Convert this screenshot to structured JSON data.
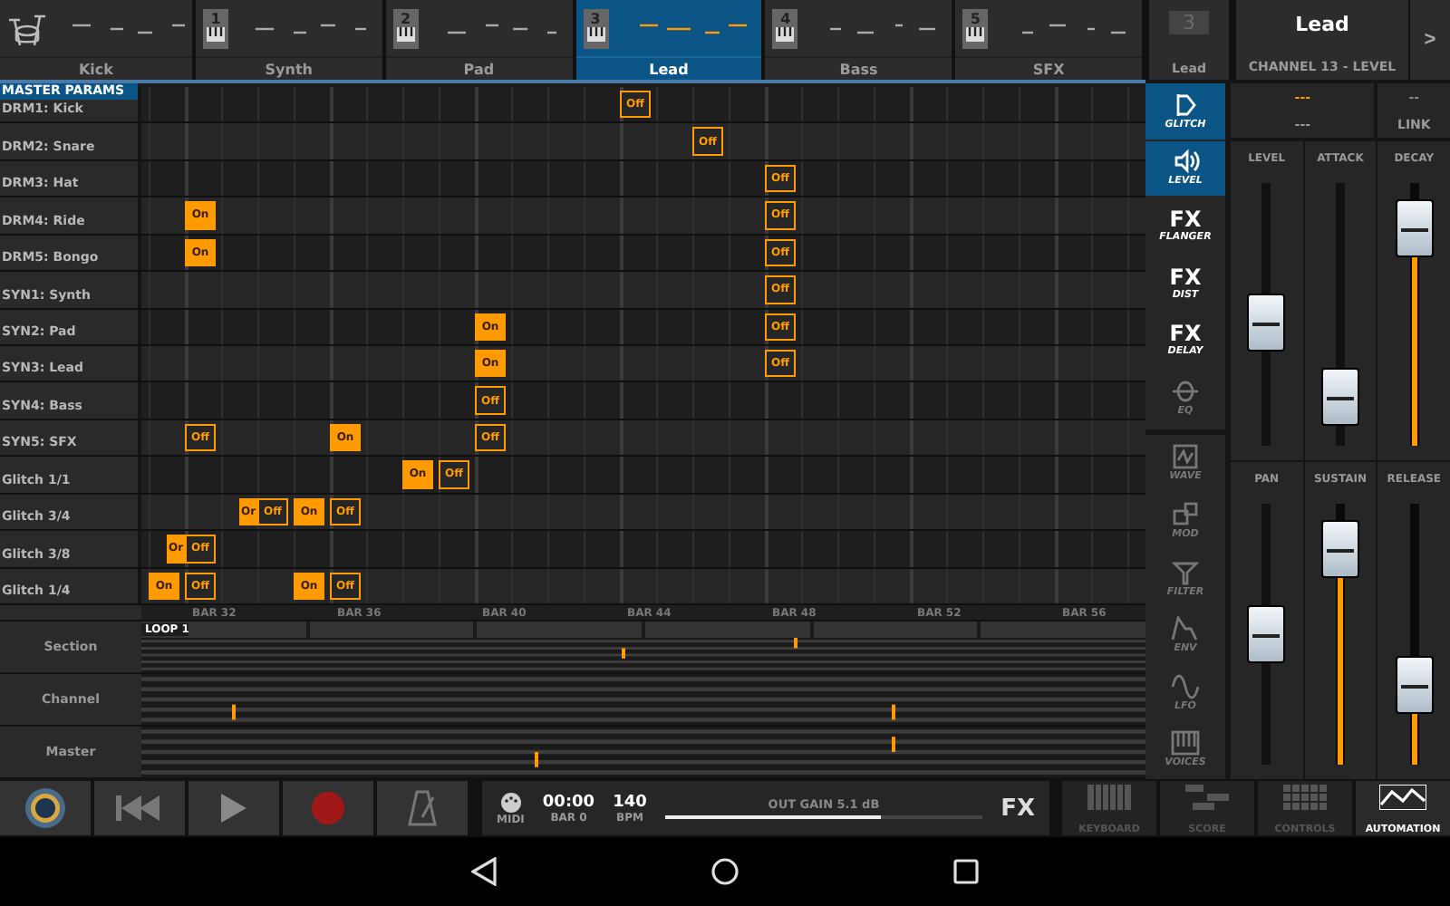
{
  "tabs": [
    {
      "label": "Kick",
      "kind": "drum",
      "selected": false
    },
    {
      "label": "Synth",
      "kind": "synth",
      "number": "1",
      "selected": false
    },
    {
      "label": "Pad",
      "kind": "synth",
      "number": "2",
      "selected": false
    },
    {
      "label": "Lead",
      "kind": "synth",
      "number": "3",
      "selected": true
    },
    {
      "label": "Bass",
      "kind": "synth",
      "number": "4",
      "selected": false
    },
    {
      "label": "SFX",
      "kind": "synth",
      "number": "5",
      "selected": false
    }
  ],
  "channel_box": {
    "number": "3",
    "label": "Lead"
  },
  "channel_title": {
    "name": "Lead",
    "subtitle": "CHANNEL 13 - LEVEL",
    "next": ">"
  },
  "grid": {
    "header": "MASTER PARAMS",
    "rows": [
      {
        "label": "DRM1: Kick",
        "cells": [
          null,
          null,
          null,
          null,
          null,
          null,
          null,
          null,
          null,
          null,
          null,
          null,
          null,
          null,
          null,
          null,
          null,
          null,
          null,
          null,
          null,
          null,
          null,
          null,
          null,
          null,
          {
            "label": "Off",
            "kind": "off"
          }
        ]
      },
      {
        "label": "DRM2: Snare",
        "cells": [
          null,
          null,
          null,
          null,
          null,
          null,
          null,
          null,
          null,
          null,
          null,
          null,
          null,
          null,
          null,
          null,
          null,
          null,
          null,
          null,
          null,
          null,
          null,
          null,
          null,
          null,
          null,
          null,
          null,
          null,
          {
            "label": "Off",
            "kind": "off"
          }
        ]
      },
      {
        "label": "DRM3: Hat",
        "cells": [
          null,
          null,
          null,
          null,
          null,
          null,
          null,
          null,
          null,
          null,
          null,
          null,
          null,
          null,
          null,
          null,
          null,
          null,
          null,
          null,
          null,
          null,
          null,
          null,
          null,
          null,
          null,
          null,
          null,
          null,
          null,
          null,
          null,
          null,
          {
            "label": "Off",
            "kind": "off"
          }
        ]
      },
      {
        "label": "DRM4: Ride",
        "cells": [
          null,
          null,
          {
            "label": "On",
            "kind": "on"
          },
          null,
          null,
          null,
          null,
          null,
          null,
          null,
          null,
          null,
          null,
          null,
          null,
          null,
          null,
          null,
          null,
          null,
          null,
          null,
          null,
          null,
          null,
          null,
          null,
          null,
          null,
          null,
          null,
          null,
          null,
          null,
          {
            "label": "Off",
            "kind": "off"
          }
        ]
      },
      {
        "label": "DRM5: Bongo",
        "cells": [
          null,
          null,
          {
            "label": "On",
            "kind": "on"
          },
          null,
          null,
          null,
          null,
          null,
          null,
          null,
          null,
          null,
          null,
          null,
          null,
          null,
          null,
          null,
          null,
          null,
          null,
          null,
          null,
          null,
          null,
          null,
          null,
          null,
          null,
          null,
          null,
          null,
          null,
          null,
          {
            "label": "Off",
            "kind": "off"
          }
        ]
      },
      {
        "label": "SYN1: Synth",
        "cells": [
          null,
          null,
          null,
          null,
          null,
          null,
          null,
          null,
          null,
          null,
          null,
          null,
          null,
          null,
          null,
          null,
          null,
          null,
          null,
          null,
          null,
          null,
          null,
          null,
          null,
          null,
          null,
          null,
          null,
          null,
          null,
          null,
          null,
          null,
          {
            "label": "Off",
            "kind": "off"
          }
        ]
      },
      {
        "label": "SYN2: Pad",
        "cells": [
          null,
          null,
          null,
          null,
          null,
          null,
          null,
          null,
          null,
          null,
          null,
          null,
          null,
          null,
          null,
          null,
          null,
          null,
          {
            "label": "On",
            "kind": "on"
          },
          null,
          null,
          null,
          null,
          null,
          null,
          null,
          null,
          null,
          null,
          null,
          null,
          null,
          null,
          null,
          {
            "label": "Off",
            "kind": "off"
          }
        ]
      },
      {
        "label": "SYN3: Lead",
        "cells": [
          null,
          null,
          null,
          null,
          null,
          null,
          null,
          null,
          null,
          null,
          null,
          null,
          null,
          null,
          null,
          null,
          null,
          null,
          {
            "label": "On",
            "kind": "on"
          },
          null,
          null,
          null,
          null,
          null,
          null,
          null,
          null,
          null,
          null,
          null,
          null,
          null,
          null,
          null,
          {
            "label": "Off",
            "kind": "off"
          }
        ]
      },
      {
        "label": "SYN4: Bass",
        "cells": [
          null,
          null,
          null,
          null,
          null,
          null,
          null,
          null,
          null,
          null,
          null,
          null,
          null,
          null,
          null,
          null,
          null,
          null,
          {
            "label": "Off",
            "kind": "off"
          }
        ]
      },
      {
        "label": "SYN5: SFX",
        "cells": [
          null,
          null,
          {
            "label": "Off",
            "kind": "off"
          },
          null,
          null,
          null,
          null,
          null,
          null,
          null,
          {
            "label": "On",
            "kind": "on"
          },
          null,
          null,
          null,
          null,
          null,
          null,
          null,
          {
            "label": "Off",
            "kind": "off"
          }
        ]
      },
      {
        "label": "Glitch 1/1",
        "cells": [
          null,
          null,
          null,
          null,
          null,
          null,
          null,
          null,
          null,
          null,
          null,
          null,
          null,
          null,
          {
            "label": "On",
            "kind": "on"
          },
          null,
          {
            "label": "Off",
            "kind": "off"
          }
        ]
      },
      {
        "label": "Glitch 3/4",
        "cells": [
          null,
          null,
          null,
          null,
          null,
          {
            "label": "Or",
            "kind": "on"
          },
          {
            "label": "Off",
            "kind": "off"
          },
          null,
          {
            "label": "On",
            "kind": "on"
          },
          null,
          {
            "label": "Off",
            "kind": "off"
          }
        ]
      },
      {
        "label": "Glitch 3/8",
        "cells": [
          null,
          {
            "label": "Or",
            "kind": "on"
          },
          {
            "label": "Off",
            "kind": "off"
          }
        ]
      },
      {
        "label": "Glitch 1/4",
        "cells": [
          {
            "label": "On",
            "kind": "on"
          },
          null,
          {
            "label": "Off",
            "kind": "off"
          },
          null,
          null,
          null,
          null,
          null,
          {
            "label": "On",
            "kind": "on"
          },
          null,
          {
            "label": "Off",
            "kind": "off"
          }
        ]
      }
    ],
    "bars": [
      "BAR 32",
      "BAR 36",
      "BAR 40",
      "BAR 44",
      "BAR 48",
      "BAR 52",
      "BAR 56"
    ]
  },
  "automation": {
    "lanes": [
      "Section",
      "Channel",
      "Master"
    ],
    "loop": "LOOP 1"
  },
  "modules": [
    {
      "label": "GLITCH",
      "kind": "glitch",
      "selected": true,
      "disabled": false
    },
    {
      "label": "LEVEL",
      "kind": "level",
      "selected": true,
      "disabled": false
    },
    {
      "label": "FLANGER",
      "kind": "fx",
      "badge": "FX",
      "selected": false,
      "disabled": false
    },
    {
      "label": "DIST",
      "kind": "fx",
      "badge": "FX",
      "selected": false,
      "disabled": false
    },
    {
      "label": "DELAY",
      "kind": "fx",
      "badge": "FX",
      "selected": false,
      "disabled": false
    },
    {
      "label": "EQ",
      "kind": "eq",
      "selected": false,
      "disabled": true
    },
    {
      "label": "WAVE",
      "kind": "wave",
      "selected": false,
      "disabled": true
    },
    {
      "label": "MOD",
      "kind": "mod",
      "selected": false,
      "disabled": true
    },
    {
      "label": "FILTER",
      "kind": "filter",
      "selected": false,
      "disabled": true
    },
    {
      "label": "ENV",
      "kind": "env",
      "selected": false,
      "disabled": true
    },
    {
      "label": "LFO",
      "kind": "lfo",
      "selected": false,
      "disabled": true
    },
    {
      "label": "VOICES",
      "kind": "voices",
      "selected": false,
      "disabled": true
    }
  ],
  "params": {
    "header": [
      {
        "value": "---",
        "label": "---",
        "highlighted": true
      },
      {
        "value": "--",
        "label": "LINK",
        "highlighted": false
      }
    ],
    "sliders": [
      {
        "label": "LEVEL",
        "level": 0.46,
        "active": false
      },
      {
        "label": "ATTACK",
        "level": 0.09,
        "active": false
      },
      {
        "label": "DECAY",
        "level": 0.92,
        "active": true
      },
      {
        "label": "PAN",
        "level": 0.5,
        "active": false
      },
      {
        "label": "SUSTAIN",
        "level": 0.92,
        "active": true
      },
      {
        "label": "RELEASE",
        "level": 0.25,
        "active": true
      }
    ]
  },
  "transport": {
    "buttons": [
      {
        "kind": "logo"
      },
      {
        "kind": "rewind"
      },
      {
        "kind": "play"
      },
      {
        "kind": "record"
      },
      {
        "kind": "metronome"
      }
    ],
    "midi": "MIDI",
    "time": "00:00",
    "bar": "BAR 0",
    "bpm": "140",
    "bpm_label": "BPM",
    "gain": "OUT GAIN 5.1 dB",
    "gain_meter": {
      "level": 0.68
    },
    "fx": "FX"
  },
  "views": [
    {
      "label": "KEYBOARD",
      "kind": "keyboard",
      "selected": false
    },
    {
      "label": "SCORE",
      "kind": "score",
      "selected": false
    },
    {
      "label": "CONTROLS",
      "kind": "controls",
      "selected": false
    },
    {
      "label": "AUTOMATION",
      "kind": "automation",
      "selected": true
    }
  ]
}
